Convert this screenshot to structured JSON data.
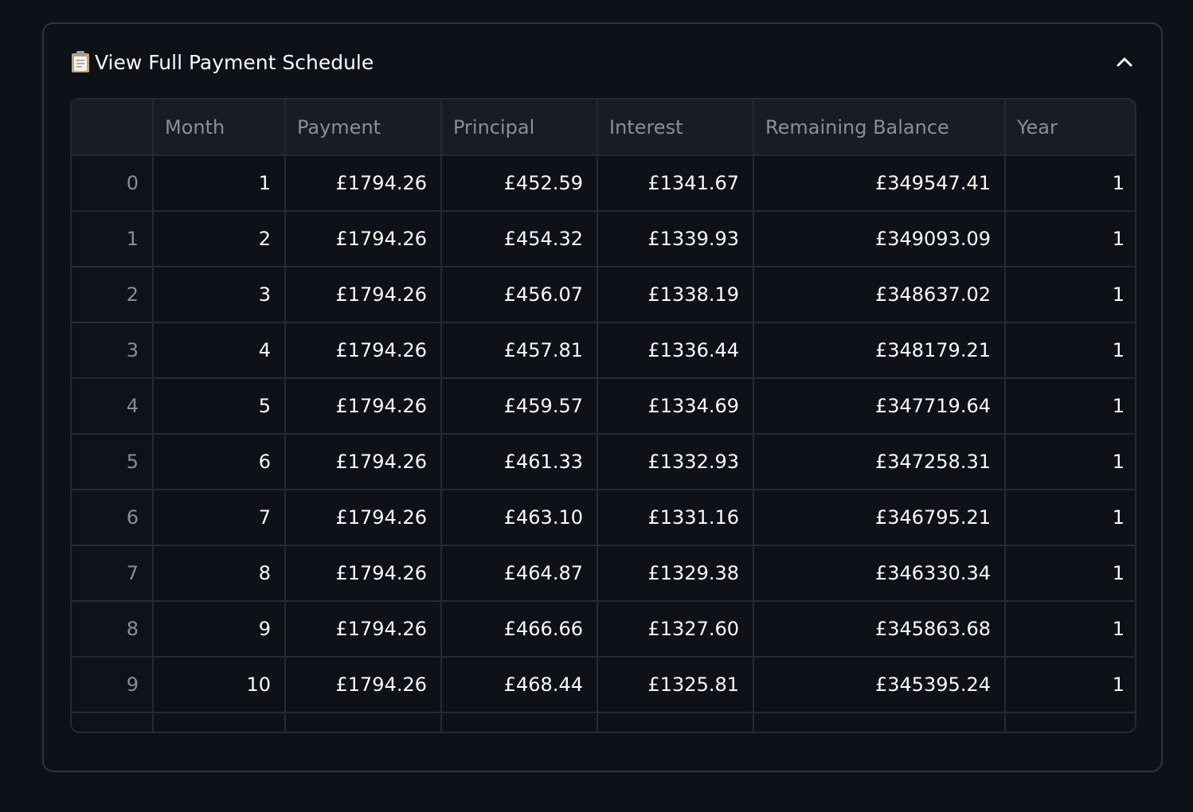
{
  "expander": {
    "title": "View Full Payment Schedule",
    "title_icon": "clipboard-icon",
    "toggle_icon": "chevron-up-icon",
    "expanded": true
  },
  "table": {
    "columns": [
      "",
      "Month",
      "Payment",
      "Principal",
      "Interest",
      "Remaining Balance",
      "Year"
    ],
    "rows": [
      [
        "0",
        "1",
        "£1794.26",
        "£452.59",
        "£1341.67",
        "£349547.41",
        "1"
      ],
      [
        "1",
        "2",
        "£1794.26",
        "£454.32",
        "£1339.93",
        "£349093.09",
        "1"
      ],
      [
        "2",
        "3",
        "£1794.26",
        "£456.07",
        "£1338.19",
        "£348637.02",
        "1"
      ],
      [
        "3",
        "4",
        "£1794.26",
        "£457.81",
        "£1336.44",
        "£348179.21",
        "1"
      ],
      [
        "4",
        "5",
        "£1794.26",
        "£459.57",
        "£1334.69",
        "£347719.64",
        "1"
      ],
      [
        "5",
        "6",
        "£1794.26",
        "£461.33",
        "£1332.93",
        "£347258.31",
        "1"
      ],
      [
        "6",
        "7",
        "£1794.26",
        "£463.10",
        "£1331.16",
        "£346795.21",
        "1"
      ],
      [
        "7",
        "8",
        "£1794.26",
        "£464.87",
        "£1329.38",
        "£346330.34",
        "1"
      ],
      [
        "8",
        "9",
        "£1794.26",
        "£466.66",
        "£1327.60",
        "£345863.68",
        "1"
      ],
      [
        "9",
        "10",
        "£1794.26",
        "£468.44",
        "£1325.81",
        "£345395.24",
        "1"
      ]
    ]
  },
  "colors": {
    "background": "#0e1117",
    "border": "#31333f",
    "grid": "#262a33",
    "header_bg": "#1a1c24",
    "muted_text": "#8b8e97",
    "text": "#fafafa"
  }
}
